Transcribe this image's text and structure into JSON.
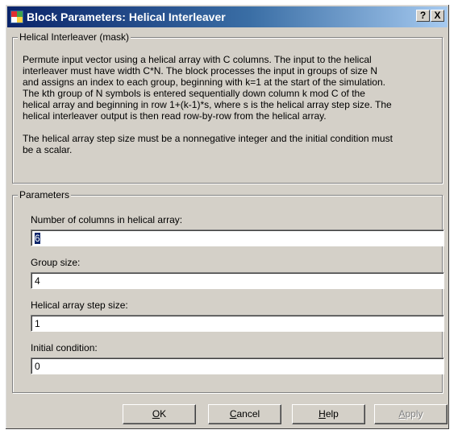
{
  "window": {
    "title": "Block Parameters: Helical Interleaver",
    "help_button": "?",
    "close_button": "X"
  },
  "mask": {
    "group_label": "Helical Interleaver (mask)",
    "description_1": "Permute input vector using a helical array with C columns.  The input to the helical\ninterleaver must have width C*N.  The block processes the input in groups of size N\nand assigns an index to each group, beginning with k=1 at the start of the simulation.\nThe kth group of N symbols is entered sequentially down column k mod C of the\nhelical array and beginning in row 1+(k-1)*s, where s is the helical array step size.  The\nhelical interleaver output is then read row-by-row from the helical array.",
    "description_2": "The helical array step size must be a nonnegative integer and the initial condition must\nbe a scalar."
  },
  "parameters": {
    "group_label": "Parameters",
    "fields": [
      {
        "label": "Number of columns in helical array:",
        "value": "6"
      },
      {
        "label": "Group size:",
        "value": "4"
      },
      {
        "label": "Helical array step size:",
        "value": "1"
      },
      {
        "label": "Initial condition:",
        "value": "0"
      }
    ]
  },
  "buttons": {
    "ok": {
      "mnemonic": "O",
      "rest": "K"
    },
    "cancel": {
      "mnemonic": "C",
      "rest": "ancel"
    },
    "help": {
      "mnemonic": "H",
      "rest": "elp"
    },
    "apply": {
      "mnemonic": "A",
      "rest": "pply"
    }
  },
  "icons": {
    "title_icon": "simulink-block-icon"
  }
}
